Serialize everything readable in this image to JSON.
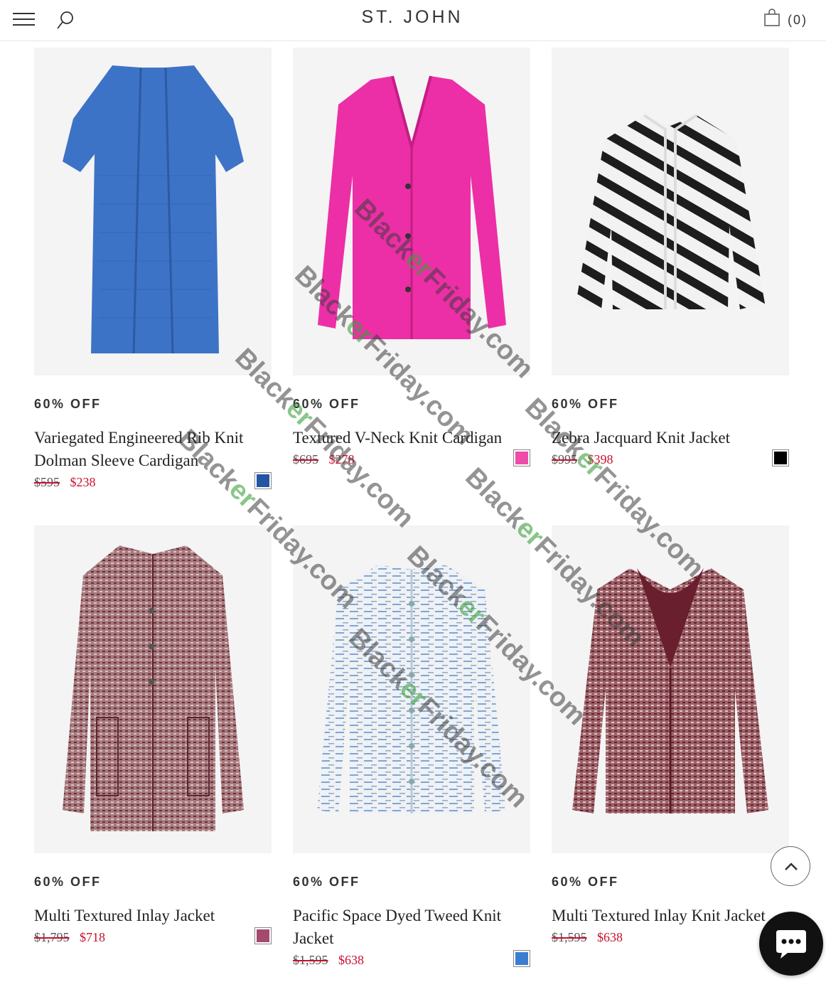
{
  "header": {
    "logo": "ST. JOHN",
    "bag_count": "(0)",
    "menu_icon": "hamburger-menu-icon",
    "search_icon": "search-icon",
    "bag_icon": "shopping-bag-icon"
  },
  "products": [
    {
      "discount": "60% OFF",
      "name": "Variegated Engineered Rib Knit Dolman Sleeve Cardigan",
      "old_price": "$595",
      "new_price": "$238",
      "swatch_color": "#2454a4",
      "garment_color": "#3d73c6"
    },
    {
      "discount": "60% OFF",
      "name": "Textured V-Neck Knit Cardigan",
      "old_price": "$695",
      "new_price": "$278",
      "swatch_color": "#f04aaa",
      "garment_color": "#ec2fa6"
    },
    {
      "discount": "60% OFF",
      "name": "Zebra Jacquard Knit Jacket",
      "old_price": "$995",
      "new_price": "$398",
      "swatch_color": "#000000",
      "garment_color": "#1d1d1d"
    },
    {
      "discount": "60% OFF",
      "name": "Multi Textured Inlay Jacket",
      "old_price": "$1,795",
      "new_price": "$718",
      "swatch_color": "#a44a6e",
      "garment_color": "#9b6a70"
    },
    {
      "discount": "60% OFF",
      "name": "Pacific Space Dyed Tweed Knit Jacket",
      "old_price": "$1,595",
      "new_price": "$638",
      "swatch_color": "#3b7ed0",
      "garment_color": "#eef1f5"
    },
    {
      "discount": "60% OFF",
      "name": "Multi Textured Inlay Knit Jacket",
      "old_price": "$1,595",
      "new_price": "$638",
      "swatch_color": null,
      "garment_color": "#8e4a55"
    }
  ],
  "watermark": {
    "text_before": "Black",
    "text_highlight": "er",
    "text_after": "Friday.com"
  },
  "colors": {
    "sale_red": "#c8102e",
    "image_background": "#f4f4f4"
  },
  "floating": {
    "scroll_top_icon": "chevron-up-icon",
    "chat_icon": "chat-bubble-icon"
  }
}
